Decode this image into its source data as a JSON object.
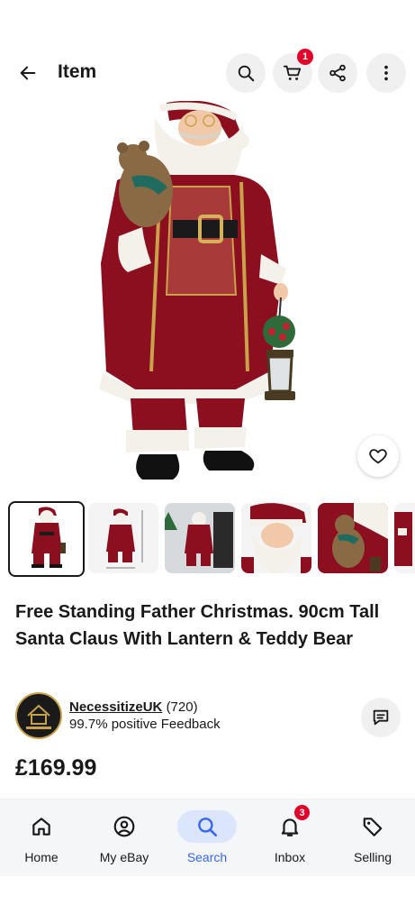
{
  "header": {
    "title": "Item",
    "cart_badge": "1",
    "icons": [
      "back-arrow-icon",
      "search-icon",
      "cart-icon",
      "share-icon",
      "more-vertical-icon"
    ]
  },
  "item": {
    "title": "Free Standing Father Christmas. 90cm Tall Santa Claus With Lantern & Teddy Bear",
    "price": "£169.99",
    "gallery_count": 6,
    "selected_thumbnail": 1
  },
  "seller": {
    "name": "NecessitizeUK",
    "feedback_count": "(720)",
    "feedback_text": "99.7% positive Feedback"
  },
  "nav": {
    "items": [
      {
        "label": "Home",
        "icon": "home-icon"
      },
      {
        "label": "My eBay",
        "icon": "user-icon"
      },
      {
        "label": "Search",
        "icon": "search-icon",
        "active": true
      },
      {
        "label": "Inbox",
        "icon": "bell-icon",
        "badge": "3"
      },
      {
        "label": "Selling",
        "icon": "tag-icon"
      }
    ]
  },
  "colors": {
    "accent": "#3665f3",
    "badge": "#e0002a",
    "text": "#191919",
    "santa_red": "#8b0f1f"
  }
}
